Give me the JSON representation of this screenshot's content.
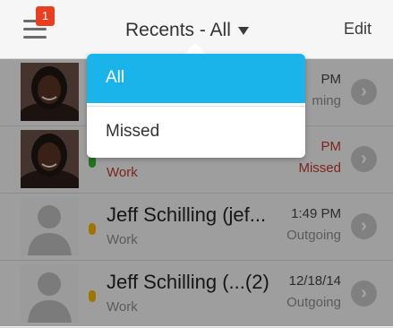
{
  "header": {
    "title": "Recents - All",
    "edit_label": "Edit",
    "notification_count": "1",
    "icons": {
      "menu": "hamburger-menu-icon",
      "dropdown": "caret-down-icon"
    }
  },
  "dropdown": {
    "options": [
      {
        "label": "All",
        "selected": true
      },
      {
        "label": "Missed",
        "selected": false
      }
    ],
    "selected_color": "#1ab4ea"
  },
  "recents": [
    {
      "name": "",
      "label": "",
      "time": "PM",
      "type": "ming",
      "status_color": "#34b233",
      "avatar": "photo"
    },
    {
      "name": "",
      "label": "Work",
      "time": "PM",
      "type": "Missed",
      "status_color": "#34b233",
      "avatar": "photo",
      "missed": true
    },
    {
      "name": "Jeff Schilling (jef...",
      "label": "Work",
      "time": "1:49 PM",
      "type": "Outgoing",
      "status_color": "#f5b400",
      "avatar": "placeholder"
    },
    {
      "name": "Jeff Schilling (...(2)",
      "label": "Work",
      "time": "12/18/14",
      "type": "Outgoing",
      "status_color": "#f5b400",
      "avatar": "placeholder"
    }
  ],
  "colors": {
    "badge": "#e83f23",
    "missed": "#c0392b"
  }
}
